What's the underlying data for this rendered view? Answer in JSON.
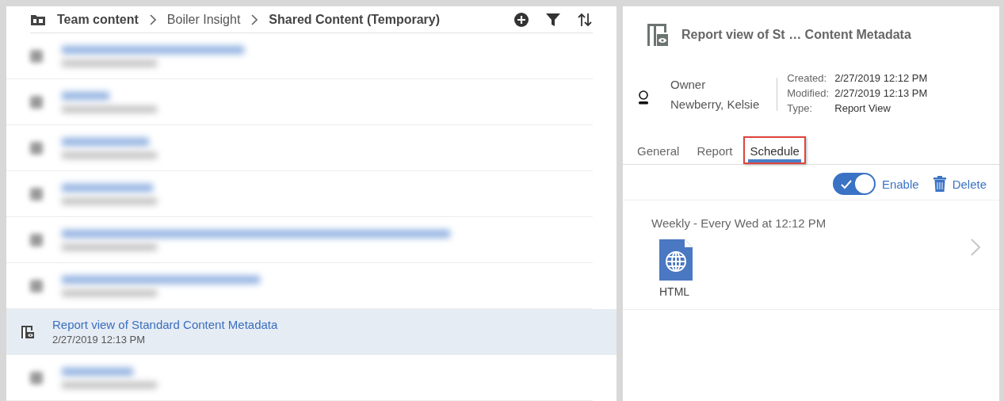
{
  "breadcrumb": [
    {
      "label": "Team content",
      "bold": true
    },
    {
      "label": "Boiler Insight",
      "bold": false
    },
    {
      "label": "Shared Content (Temporary)",
      "bold": true
    }
  ],
  "list": [
    {
      "kind": "blurred",
      "selected": false
    },
    {
      "kind": "blurred",
      "selected": false
    },
    {
      "kind": "blurred",
      "selected": false
    },
    {
      "kind": "blurred",
      "selected": false
    },
    {
      "kind": "blurred",
      "selected": false
    },
    {
      "kind": "blurred",
      "selected": false
    },
    {
      "kind": "item",
      "selected": true,
      "title": "Report view of Standard Content Metadata",
      "date": "2/27/2019 12:13 PM"
    },
    {
      "kind": "blurred",
      "selected": false
    }
  ],
  "details": {
    "title": "Report view of St … Content Metadata",
    "owner_label": "Owner",
    "owner": "Newberry, Kelsie",
    "meta": [
      {
        "label": "Created:",
        "value": "2/27/2019 12:12 PM"
      },
      {
        "label": "Modified:",
        "value": "2/27/2019 12:13 PM"
      },
      {
        "label": "Type:",
        "value": "Report View"
      }
    ],
    "tabs": [
      {
        "label": "General",
        "selected": false,
        "highlighted": false
      },
      {
        "label": "Report",
        "selected": false,
        "highlighted": false
      },
      {
        "label": "Schedule",
        "selected": true,
        "highlighted": true
      }
    ],
    "enable": {
      "label": "Enable",
      "on": true
    },
    "delete_label": "Delete",
    "schedule": {
      "summary": "Weekly - Every Wed at 12:12 PM",
      "format": "HTML"
    }
  }
}
